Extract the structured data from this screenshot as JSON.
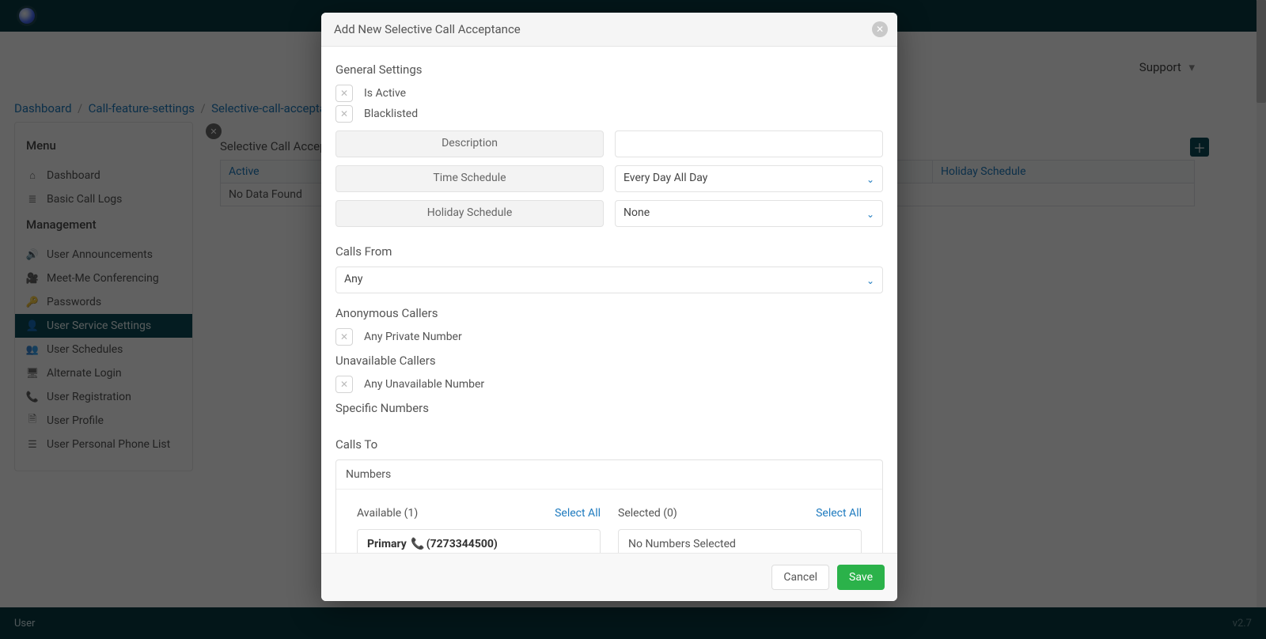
{
  "header": {
    "brand": "",
    "support_label": "Support"
  },
  "breadcrumb": {
    "dashboard": "Dashboard",
    "cfs": "Call-feature-settings",
    "sca": "Selective-call-acceptance"
  },
  "sidebar": {
    "menu_hd": "Menu",
    "mgmt_hd": "Management",
    "items": [
      {
        "label": "Dashboard",
        "icon": "⌂"
      },
      {
        "label": "Basic Call Logs",
        "icon": "≣"
      }
    ],
    "mitems": [
      {
        "label": "User Announcements",
        "icon": "🔊"
      },
      {
        "label": "Meet-Me Conferencing",
        "icon": "🎥"
      },
      {
        "label": "Passwords",
        "icon": "🔑"
      },
      {
        "label": "User Service Settings",
        "icon": "👤"
      },
      {
        "label": "User Schedules",
        "icon": "👥"
      },
      {
        "label": "Alternate Login",
        "icon": "🖥"
      },
      {
        "label": "User Registration",
        "icon": "📞"
      },
      {
        "label": "User Profile",
        "icon": "🗎"
      },
      {
        "label": "User Personal Phone List",
        "icon": "☰"
      }
    ]
  },
  "panel": {
    "title": "Selective Call Acceptance",
    "cols": {
      "active": "Active",
      "hs": "Holiday Schedule"
    },
    "nodata": "No Data Found"
  },
  "footer": {
    "user": "User",
    "ver": "v2.7"
  },
  "modal": {
    "title": "Add New Selective Call Acceptance",
    "general": "General Settings",
    "is_active": "Is Active",
    "blacklisted": "Blacklisted",
    "description_lbl": "Description",
    "description_val": "",
    "time_schedule_lbl": "Time Schedule",
    "time_schedule_val": "Every Day All Day",
    "holiday_schedule_lbl": "Holiday Schedule",
    "holiday_schedule_val": "None",
    "calls_from_hd": "Calls From",
    "calls_from_val": "Any",
    "anon_hd": "Anonymous Callers",
    "anon_val": "Any Private Number",
    "unavail_hd": "Unavailable Callers",
    "unavail_val": "Any Unavailable Number",
    "specific_hd": "Specific Numbers",
    "calls_to_hd": "Calls To",
    "numbers_hd": "Numbers",
    "avail_hd": "Available (1)",
    "selall": "Select All",
    "avail_entry_prefix": "Primary",
    "avail_entry_num": "(7273344500)",
    "sel_hd": "Selected (0)",
    "sel_empty": "No Numbers Selected",
    "cancel": "Cancel",
    "save": "Save"
  }
}
